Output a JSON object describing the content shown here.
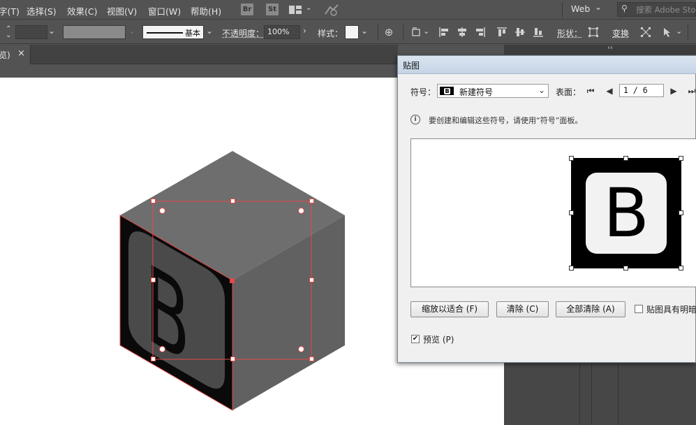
{
  "menubar": {
    "items": [
      "字(T)",
      "选择(S)",
      "效果(C)",
      "视图(V)",
      "窗口(W)",
      "帮助(H)"
    ],
    "br_label": "Br",
    "st_label": "St",
    "workspace": "Web",
    "search_placeholder": "搜索 Adobe Stock"
  },
  "controlbar": {
    "stroke_style": "基本",
    "opacity_label": "不透明度：",
    "opacity_value": "100%",
    "style_label": "样式：",
    "shape_label": "形状：",
    "transform_label": "变换"
  },
  "tab": {
    "title": "览)",
    "close": "×"
  },
  "panel_collapse": "‹‹",
  "dialog": {
    "title": "贴图",
    "symbol_label": "符号：",
    "symbol_value": "新建符号",
    "surface_label": "表面：",
    "surface_value": "1 / 6",
    "info_text": "要创建和编辑这些符号，请使用“符号”面板。",
    "preview_glyph": "B",
    "buttons": {
      "scale_fit": "缩放以适合 (F)",
      "clear": "清除 (C)",
      "clear_all": "全部清除 (A)"
    },
    "map_shading_label": "贴图具有明暗",
    "preview_label": "预览 (P)",
    "preview_checked": true
  },
  "artwork": {
    "face_glyph": "B",
    "cube_top_color": "#6e6e6e",
    "cube_right_color": "#616161",
    "cube_left_color": "#0a0a0a",
    "selection_color": "#e54848"
  }
}
